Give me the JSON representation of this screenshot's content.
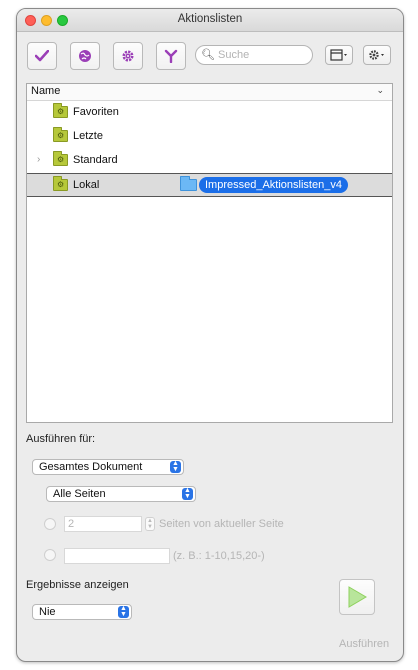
{
  "window": {
    "title": "Aktionslisten"
  },
  "toolbar": {
    "search_placeholder": "Suche"
  },
  "list": {
    "column_header": "Name",
    "items": [
      {
        "label": "Favoriten"
      },
      {
        "label": "Letzte"
      },
      {
        "label": "Standard"
      },
      {
        "label": "Lokal"
      }
    ],
    "drag_item_label": "Impressed_Aktionslisten_v4"
  },
  "run_for": {
    "label": "Ausführen für:",
    "scope_value": "Gesamtes Dokument",
    "pages_value": "Alle Seiten",
    "pages_from_current_value": "2",
    "pages_from_current_text": "Seiten von aktueller Seite",
    "page_range_value": "",
    "page_range_hint": "(z. B.: 1-10,15,20-)"
  },
  "results": {
    "label": "Ergebnisse anzeigen",
    "value": "Nie"
  },
  "run_button": {
    "label": "Ausführen"
  },
  "colors": {
    "accent": "#1b6ee8",
    "folder": "#b6c83a",
    "play": "#8ed15d"
  }
}
